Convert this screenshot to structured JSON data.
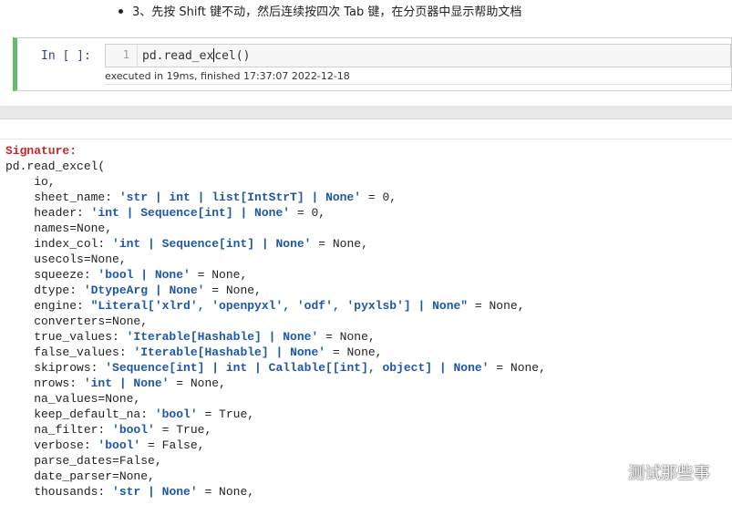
{
  "instruction": {
    "text": "3、先按 Shift 键不动，然后连续按四次 Tab 键，在分页器中显示帮助文档"
  },
  "cell": {
    "prompt": "In [ ]:",
    "line_number": "1",
    "code_before_cursor": "pd.read_ex",
    "code_after_cursor": "cel()",
    "exec_info": "executed in 19ms, finished 17:37:07 2022-12-18"
  },
  "pager": {
    "signature_label": "Signature:",
    "lines": [
      [
        {
          "t": "pd.read_excel(",
          "c": "plain"
        }
      ],
      [
        {
          "t": "    io,",
          "c": "plain"
        }
      ],
      [
        {
          "t": "    sheet_name: ",
          "c": "plain"
        },
        {
          "t": "'str | int | list[IntStrT] | None'",
          "c": "type"
        },
        {
          "t": " = 0,",
          "c": "plain"
        }
      ],
      [
        {
          "t": "    header: ",
          "c": "plain"
        },
        {
          "t": "'int | Sequence[int] | None'",
          "c": "type"
        },
        {
          "t": " = 0,",
          "c": "plain"
        }
      ],
      [
        {
          "t": "    names=None,",
          "c": "plain"
        }
      ],
      [
        {
          "t": "    index_col: ",
          "c": "plain"
        },
        {
          "t": "'int | Sequence[int] | None'",
          "c": "type"
        },
        {
          "t": " = None,",
          "c": "plain"
        }
      ],
      [
        {
          "t": "    usecols=None,",
          "c": "plain"
        }
      ],
      [
        {
          "t": "    squeeze: ",
          "c": "plain"
        },
        {
          "t": "'bool | None'",
          "c": "type"
        },
        {
          "t": " = None,",
          "c": "plain"
        }
      ],
      [
        {
          "t": "    dtype: ",
          "c": "plain"
        },
        {
          "t": "'DtypeArg | None'",
          "c": "type"
        },
        {
          "t": " = None,",
          "c": "plain"
        }
      ],
      [
        {
          "t": "    engine: ",
          "c": "plain"
        },
        {
          "t": "\"Literal['xlrd', 'openpyxl', 'odf', 'pyxlsb'] | None\"",
          "c": "type"
        },
        {
          "t": " = None,",
          "c": "plain"
        }
      ],
      [
        {
          "t": "    converters=None,",
          "c": "plain"
        }
      ],
      [
        {
          "t": "    true_values: ",
          "c": "plain"
        },
        {
          "t": "'Iterable[Hashable] | None'",
          "c": "type"
        },
        {
          "t": " = None,",
          "c": "plain"
        }
      ],
      [
        {
          "t": "    false_values: ",
          "c": "plain"
        },
        {
          "t": "'Iterable[Hashable] | None'",
          "c": "type"
        },
        {
          "t": " = None,",
          "c": "plain"
        }
      ],
      [
        {
          "t": "    skiprows: ",
          "c": "plain"
        },
        {
          "t": "'Sequence[int] | int | Callable[[int], object] | None'",
          "c": "type"
        },
        {
          "t": " = None,",
          "c": "plain"
        }
      ],
      [
        {
          "t": "    nrows: ",
          "c": "plain"
        },
        {
          "t": "'int | None'",
          "c": "type"
        },
        {
          "t": " = None,",
          "c": "plain"
        }
      ],
      [
        {
          "t": "    na_values=None,",
          "c": "plain"
        }
      ],
      [
        {
          "t": "    keep_default_na: ",
          "c": "plain"
        },
        {
          "t": "'bool'",
          "c": "type"
        },
        {
          "t": " = True,",
          "c": "plain"
        }
      ],
      [
        {
          "t": "    na_filter: ",
          "c": "plain"
        },
        {
          "t": "'bool'",
          "c": "type"
        },
        {
          "t": " = True,",
          "c": "plain"
        }
      ],
      [
        {
          "t": "    verbose: ",
          "c": "plain"
        },
        {
          "t": "'bool'",
          "c": "type"
        },
        {
          "t": " = False,",
          "c": "plain"
        }
      ],
      [
        {
          "t": "    parse_dates=False,",
          "c": "plain"
        }
      ],
      [
        {
          "t": "    date_parser=None,",
          "c": "plain"
        }
      ],
      [
        {
          "t": "    thousands: ",
          "c": "plain"
        },
        {
          "t": "'str | None'",
          "c": "type"
        },
        {
          "t": " = None,",
          "c": "plain"
        }
      ]
    ]
  },
  "watermark": {
    "text": "测试那些事",
    "icon": "wechat-icon"
  },
  "colors": {
    "cell_border_active": "#66bb6a",
    "prompt": "#303f9f",
    "signature": "#c62828",
    "type_annotation": "#1e57a8"
  }
}
